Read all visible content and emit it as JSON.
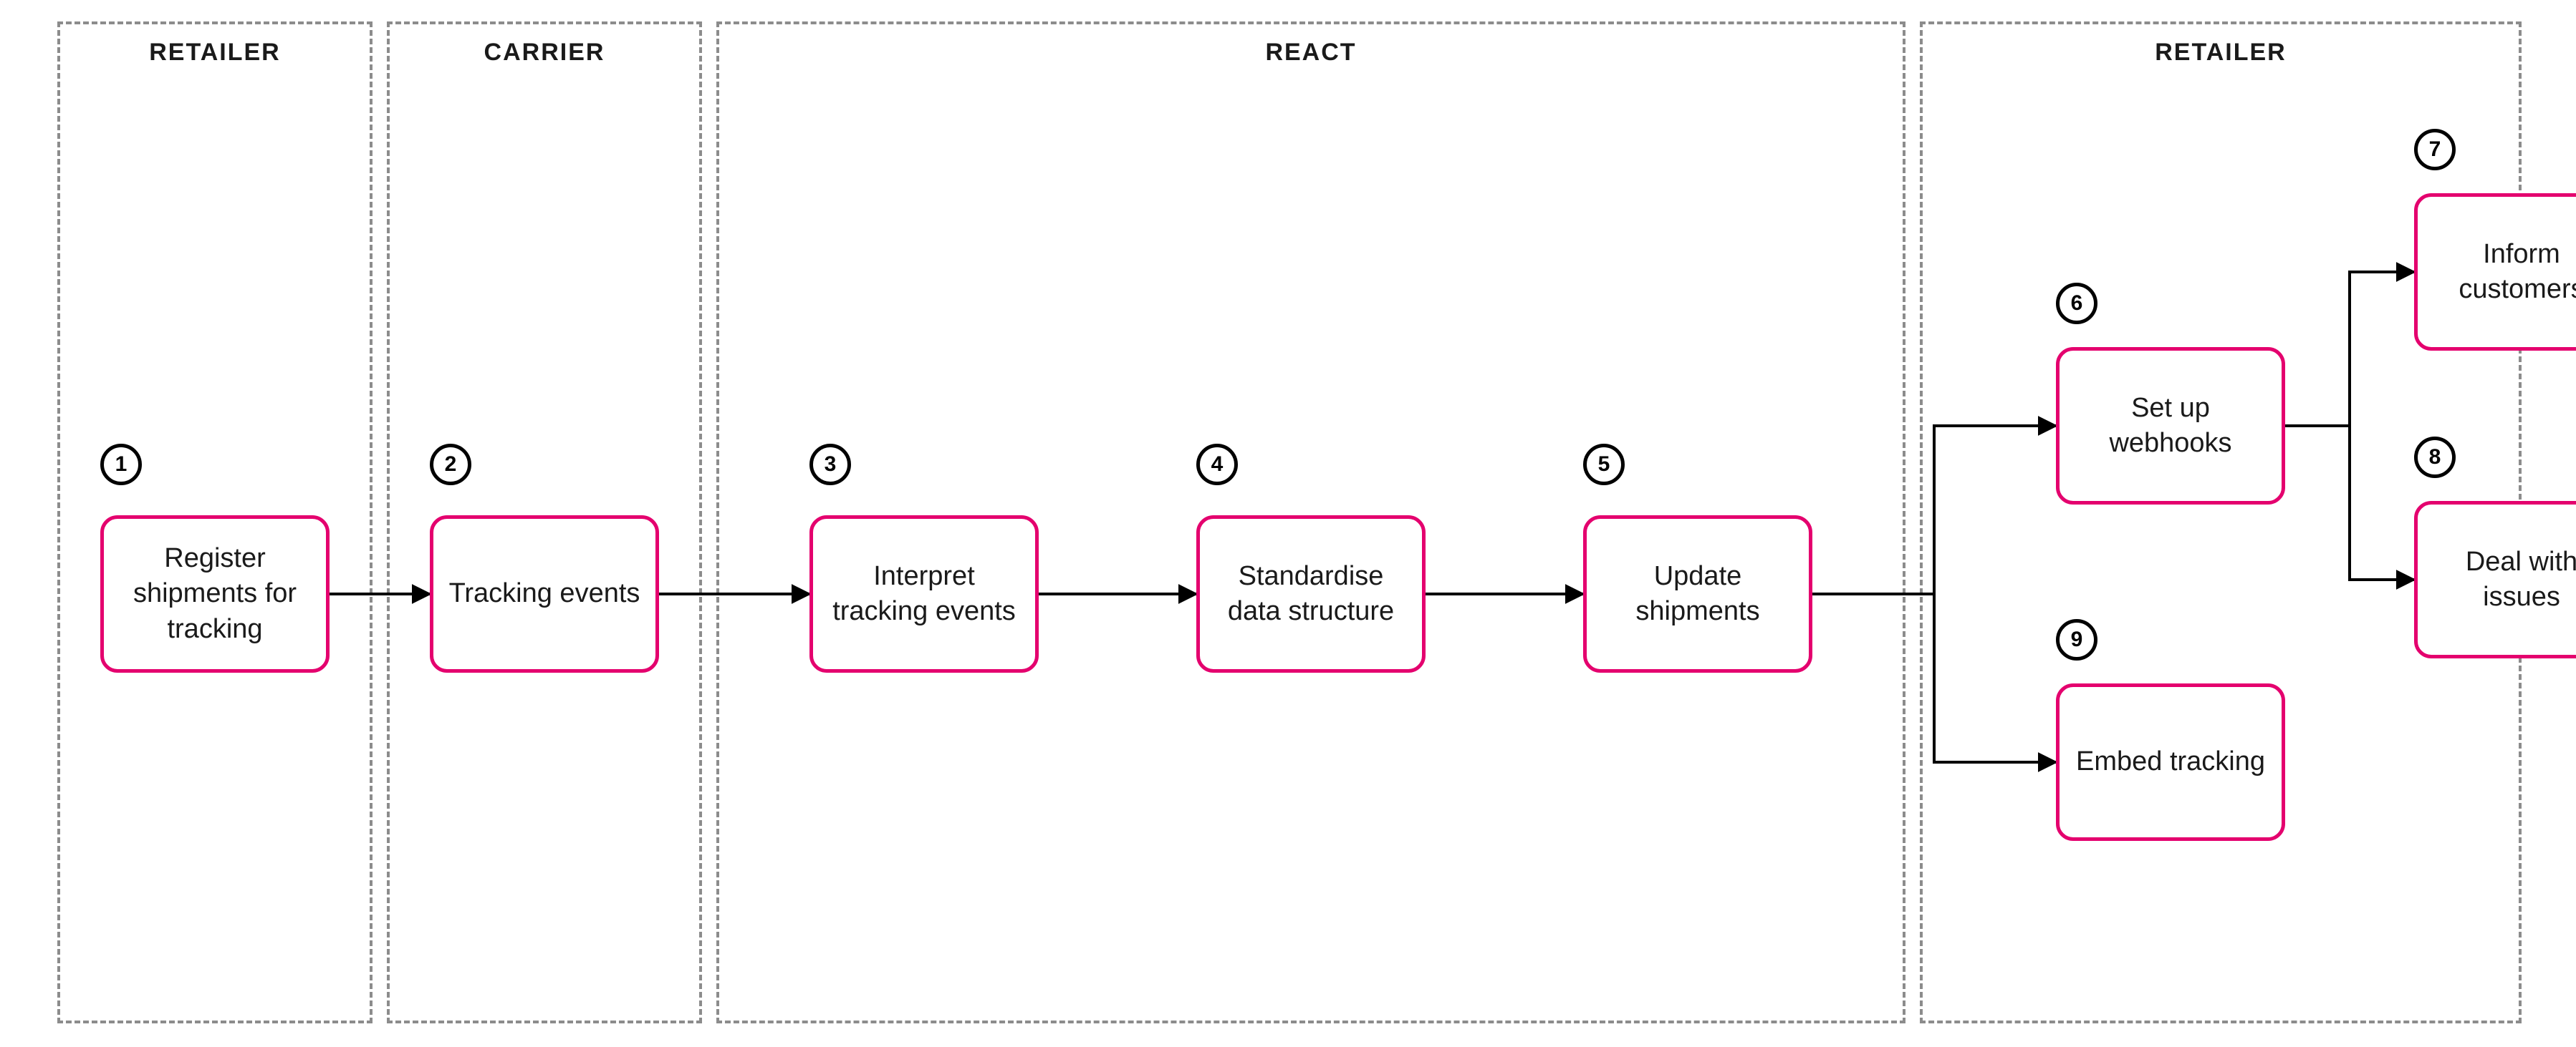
{
  "lanes": {
    "retailer1": {
      "title": "RETAILER"
    },
    "carrier": {
      "title": "CARRIER"
    },
    "react": {
      "title": "REACT"
    },
    "retailer2": {
      "title": "RETAILER"
    }
  },
  "nodes": {
    "n1": {
      "num": "1",
      "label": "Register shipments for tracking"
    },
    "n2": {
      "num": "2",
      "label": "Tracking events"
    },
    "n3": {
      "num": "3",
      "label": "Interpret tracking events"
    },
    "n4": {
      "num": "4",
      "label": "Standardise data structure"
    },
    "n5": {
      "num": "5",
      "label": "Update shipments"
    },
    "n6": {
      "num": "6",
      "label": "Set up webhooks"
    },
    "n7": {
      "num": "7",
      "label": "Inform customers"
    },
    "n8": {
      "num": "8",
      "label": "Deal with issues"
    },
    "n9": {
      "num": "9",
      "label": "Embed tracking"
    }
  },
  "colors": {
    "lane_border": "#8c8c8c",
    "node_border": "#e4006e",
    "arrow": "#000000"
  }
}
